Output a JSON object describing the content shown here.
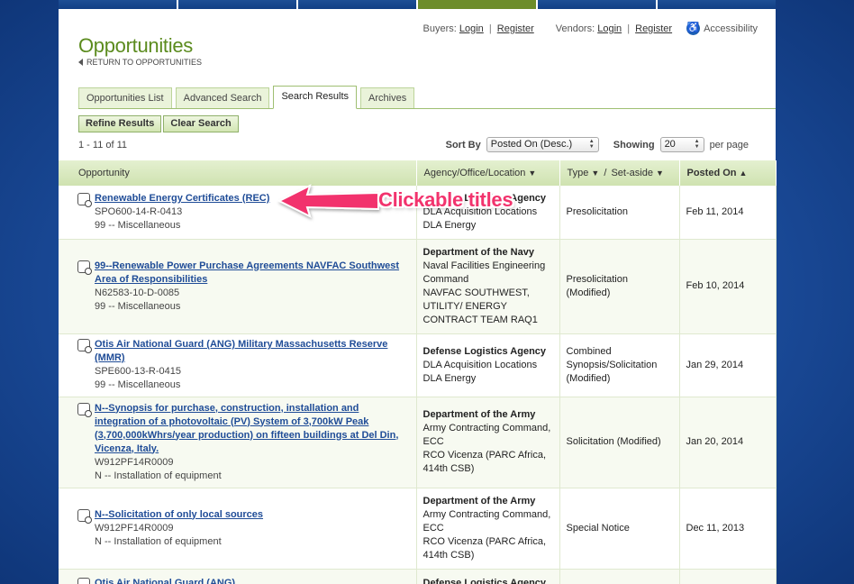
{
  "page": {
    "title": "Opportunities",
    "return_link": "RETURN TO OPPORTUNITIES"
  },
  "top_links": {
    "buyers_label": "Buyers:",
    "vendors_label": "Vendors:",
    "login": "Login",
    "register": "Register",
    "separator": "|",
    "accessibility": "Accessibility"
  },
  "tabs": [
    {
      "label": "Opportunities List",
      "active": false
    },
    {
      "label": "Advanced Search",
      "active": false
    },
    {
      "label": "Search Results",
      "active": true
    },
    {
      "label": "Archives",
      "active": false
    }
  ],
  "buttons": {
    "refine": "Refine Results",
    "clear": "Clear Search"
  },
  "results": {
    "count_text": "1 - 11 of 11",
    "sort_label": "Sort By",
    "sort_value": "Posted On (Desc.)",
    "showing_label": "Showing",
    "showing_value": "20",
    "per_page": "per page"
  },
  "table": {
    "headers": {
      "opportunity": "Opportunity",
      "agency": "Agency/Office/Location",
      "type": "Type",
      "setaside": "Set-aside",
      "slash": "/",
      "posted": "Posted On"
    },
    "rows": [
      {
        "title": "Renewable Energy Certificates (REC)",
        "number": "SPO600-14-R-0413",
        "class": "99 -- Miscellaneous",
        "agency": "Defense Logistics Agency",
        "office": "DLA Acquisition Locations",
        "location": "DLA Energy",
        "type": "Presolicitation",
        "posted": "Feb 11, 2014"
      },
      {
        "title": "99--Renewable Power Purchase Agreements NAVFAC Southwest Area of Responsibilities",
        "number": "N62583-10-D-0085",
        "class": "99 -- Miscellaneous",
        "agency": "Department of the Navy",
        "office": "Naval Facilities Engineering Command",
        "location": "NAVFAC SOUTHWEST, UTILITY/ ENERGY CONTRACT TEAM RAQ1",
        "type": "Presolicitation (Modified)",
        "posted": "Feb 10, 2014"
      },
      {
        "title": "Otis Air National Guard (ANG) Military Massachusetts Reserve (MMR)",
        "number": "SPE600-13-R-0415",
        "class": "99 -- Miscellaneous",
        "agency": "Defense Logistics Agency",
        "office": "DLA Acquisition Locations",
        "location": "DLA Energy",
        "type": "Combined Synopsis/Solicitation (Modified)",
        "posted": "Jan 29, 2014"
      },
      {
        "title": "N--Synopsis for purchase, construction, installation and integration of a photovoltaic (PV) System of 3,700kW Peak (3,700,000kWhrs/year production) on fifteen buildings at Del Din, Vicenza, Italy.",
        "number": "W912PF14R0009",
        "class": "N -- Installation of equipment",
        "agency": "Department of the Army",
        "office": "Army Contracting Command, ECC",
        "location": "RCO Vicenza (PARC Africa, 414th CSB)",
        "type": "Solicitation (Modified)",
        "posted": "Jan 20, 2014"
      },
      {
        "title": "N--Solicitation of only local sources",
        "number": "W912PF14R0009",
        "class": "N -- Installation of equipment",
        "agency": "Department of the Army",
        "office": "Army Contracting Command, ECC",
        "location": "RCO Vicenza (PARC Africa, 414th CSB)",
        "type": "Special Notice",
        "posted": "Dec 11, 2013"
      },
      {
        "title": "Otis Air National Guard (ANG)",
        "number": "",
        "class": "",
        "agency": "Defense Logistics Agency",
        "office": "",
        "location": "",
        "type": "",
        "posted": ""
      }
    ]
  },
  "annotation": {
    "text": "Clickable titles",
    "color": "#f2336d"
  },
  "colors": {
    "title_green": "#5b8b1e",
    "link_blue": "#1f4c97",
    "header_green": "#cfe2b0",
    "background_blue": "#1a4a98"
  }
}
